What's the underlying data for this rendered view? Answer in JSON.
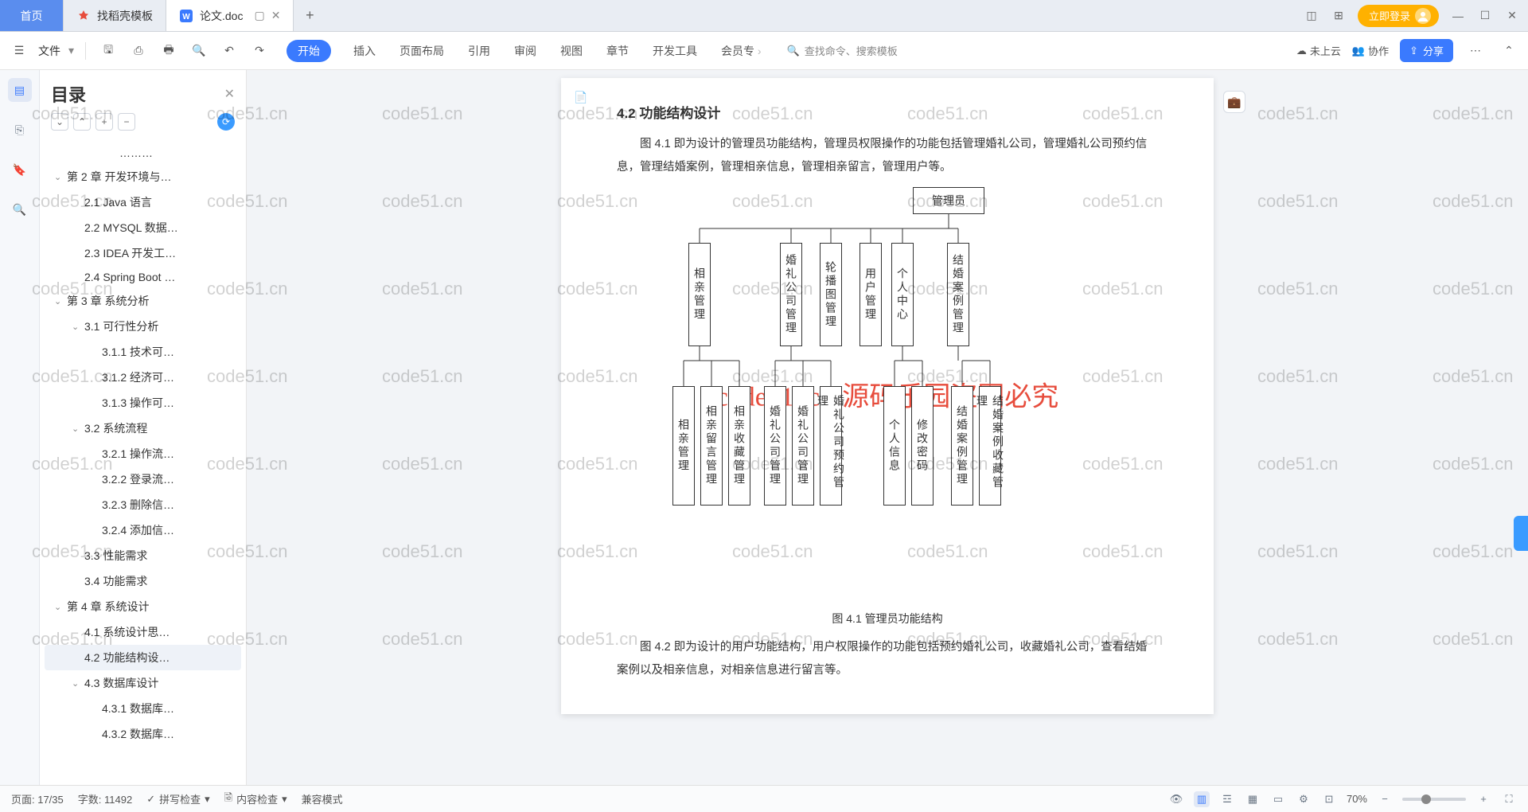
{
  "tabs": {
    "home": "首页",
    "template": "找稻壳模板",
    "doc": "论文.doc",
    "new": "+"
  },
  "login": "立即登录",
  "menu": {
    "file": "文件",
    "start": "开始",
    "insert": "插入",
    "layout": "页面布局",
    "ref": "引用",
    "review": "审阅",
    "view": "视图",
    "chapter": "章节",
    "dev": "开发工具",
    "member": "会员专",
    "search": "查找命令、搜索模板",
    "cloud": "未上云",
    "coop": "协作",
    "share": "分享"
  },
  "outline": {
    "title": "目录",
    "items": [
      {
        "t": "………",
        "d": 3
      },
      {
        "t": "第 2 章  开发环境与…",
        "d": 0,
        "c": "v"
      },
      {
        "t": "2.1 Java 语言",
        "d": 1
      },
      {
        "t": "2.2 MYSQL 数据…",
        "d": 1
      },
      {
        "t": "2.3 IDEA 开发工…",
        "d": 1
      },
      {
        "t": "2.4 Spring Boot …",
        "d": 1
      },
      {
        "t": "第 3 章  系统分析",
        "d": 0,
        "c": "v"
      },
      {
        "t": "3.1 可行性分析",
        "d": 1,
        "c": "v"
      },
      {
        "t": "3.1.1 技术可…",
        "d": 2
      },
      {
        "t": "3.1.2 经济可…",
        "d": 2
      },
      {
        "t": "3.1.3 操作可…",
        "d": 2
      },
      {
        "t": "3.2 系统流程",
        "d": 1,
        "c": "v"
      },
      {
        "t": "3.2.1 操作流…",
        "d": 2
      },
      {
        "t": "3.2.2 登录流…",
        "d": 2
      },
      {
        "t": "3.2.3 删除信…",
        "d": 2
      },
      {
        "t": "3.2.4 添加信…",
        "d": 2
      },
      {
        "t": "3.3 性能需求",
        "d": 1
      },
      {
        "t": "3.4 功能需求",
        "d": 1
      },
      {
        "t": "第 4 章  系统设计",
        "d": 0,
        "c": "v"
      },
      {
        "t": "4.1 系统设计思…",
        "d": 1
      },
      {
        "t": "4.2 功能结构设…",
        "d": 1,
        "sel": true
      },
      {
        "t": "4.3 数据库设计",
        "d": 1,
        "c": "v"
      },
      {
        "t": "4.3.1 数据库…",
        "d": 2
      },
      {
        "t": "4.3.2 数据库…",
        "d": 2
      }
    ]
  },
  "doc": {
    "h": "4.2  功能结构设计",
    "p1": "图 4.1 即为设计的管理员功能结构，管理员权限操作的功能包括管理婚礼公司，管理婚礼公司预约信息，管理结婚案例，管理相亲信息，管理相亲留言，管理用户等。",
    "root": "管理员",
    "row1": [
      "相亲管理",
      "婚礼公司管理",
      "轮播图管理",
      "用户管理",
      "个人中心",
      "结婚案例管理"
    ],
    "row2": [
      "相亲管理",
      "相亲留言管理",
      "相亲收藏管理",
      "婚礼公司管理",
      "婚礼公司管理",
      "婚礼公司预约管理",
      "个人信息",
      "修改密码",
      "结婚案例管理",
      "结婚案例收藏管理"
    ],
    "cap": "图 4.1  管理员功能结构",
    "p2": "图 4.2 即为设计的用户功能结构，用户权限操作的功能包括预约婚礼公司，收藏婚礼公司，查看结婚案例以及相亲信息，对相亲信息进行留言等。",
    "wm": "code51. cn-源码乐园盗图必究",
    "wm2": "code51.cn"
  },
  "status": {
    "page": "页面: 17/35",
    "words": "字数: 11492",
    "spell": "拼写检查",
    "content": "内容检查",
    "compat": "兼容模式",
    "zoom": "70%"
  }
}
